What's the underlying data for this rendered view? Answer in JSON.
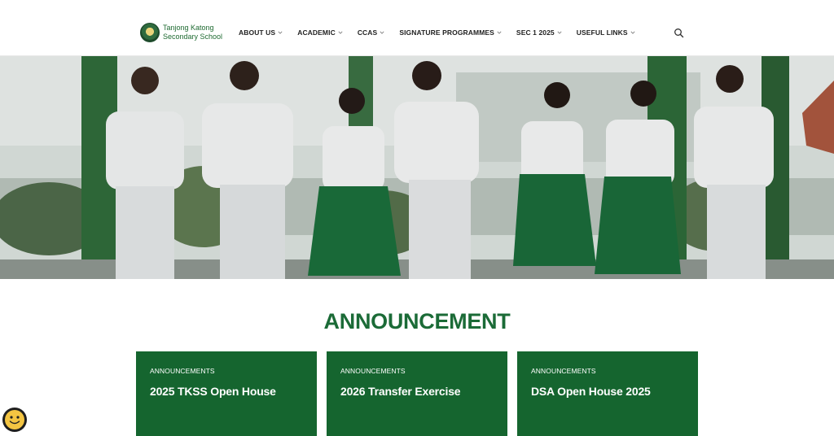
{
  "header": {
    "logo_line1": "Tanjong Katong",
    "logo_line2": "Secondary School",
    "nav": [
      {
        "label": "ABOUT US"
      },
      {
        "label": "ACADEMIC"
      },
      {
        "label": "CCAS"
      },
      {
        "label": "SIGNATURE PROGRAMMES"
      },
      {
        "label": "SEC 1 2025"
      },
      {
        "label": "USEFUL LINKS"
      }
    ]
  },
  "announcement": {
    "title": "ANNOUNCEMENT",
    "cards": [
      {
        "category": "ANNOUNCEMENTS",
        "title": "2025 TKSS Open House"
      },
      {
        "category": "ANNOUNCEMENTS",
        "title": "2026 Transfer Exercise"
      },
      {
        "category": "ANNOUNCEMENTS",
        "title": "DSA Open House 2025"
      }
    ]
  },
  "colors": {
    "brand_green": "#15652f",
    "heading_green": "#1b6b37"
  },
  "icons": {
    "search": "search-icon",
    "chevron": "chevron-down-icon",
    "chat": "smiley-chat-icon"
  }
}
